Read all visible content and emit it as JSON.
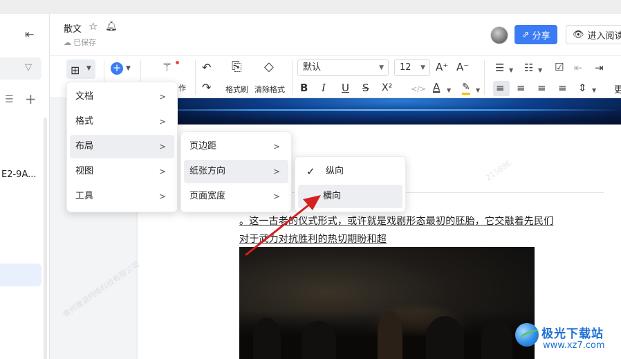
{
  "sidebar": {
    "collapse_icon": "collapse-sidebar-icon",
    "filter_icon": "filter-icon",
    "list_icon": "list-check-icon",
    "plus_icon": "plus-icon",
    "file_name": "E2-9A..."
  },
  "header": {
    "title": "散文",
    "save_status": "已保存",
    "share_label": "分享",
    "read_label": "进入阅读",
    "accent_color": "#3b7cf5"
  },
  "toolbar": {
    "ai_label": "作",
    "format_brush_label": "格式刷",
    "clear_format_label": "清除格式",
    "font_value": "默认",
    "font_size_value": "12",
    "font_grow": "A⁺",
    "font_shrink": "A⁻",
    "bold": "B",
    "italic": "I",
    "underline": "U",
    "strike": "S",
    "superscript": "X²",
    "code": "</>",
    "font_color": "A",
    "highlight": "✎",
    "more_label": "更"
  },
  "menus": {
    "main": [
      "文档",
      "格式",
      "布局",
      "视图",
      "工具"
    ],
    "layout": [
      "页边距",
      "纸张方向",
      "页面宽度"
    ],
    "orientation": [
      "纵向",
      "横向"
    ],
    "orientation_checked": "纵向"
  },
  "document": {
    "line1": "。这一古老的仪式形式，或许就是戏剧形态最初的胚胎，它交融着先民们",
    "line2": "对于武力对抗胜利的热切期盼和超"
  },
  "watermark": {
    "text1": "21589E",
    "text2": "贵州雅滋网络科技有限公司"
  },
  "site_logo": {
    "name": "极光下载站",
    "url": "www.xz7.com"
  }
}
